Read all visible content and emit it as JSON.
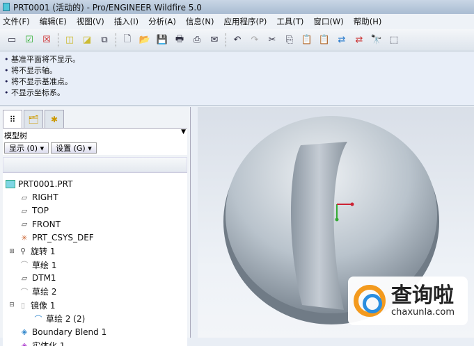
{
  "title": "PRT0001 (活动的) - Pro/ENGINEER Wildfire 5.0",
  "menu": [
    "文件(F)",
    "编辑(E)",
    "视图(V)",
    "插入(I)",
    "分析(A)",
    "信息(N)",
    "应用程序(P)",
    "工具(T)",
    "窗口(W)",
    "帮助(H)"
  ],
  "messages": [
    "基准平面将不显示。",
    "将不显示轴。",
    "将不显示基准点。",
    "不显示坐标系。"
  ],
  "model_tree": {
    "label": "模型树",
    "show_button": "显示 (0) ▾",
    "settings_button": "设置 (G) ▾",
    "nodes": [
      {
        "label": "PRT0001.PRT",
        "icon": "part-icon"
      },
      {
        "label": "RIGHT",
        "icon": "datum-plane-icon"
      },
      {
        "label": "TOP",
        "icon": "datum-plane-icon"
      },
      {
        "label": "FRONT",
        "icon": "datum-plane-icon"
      },
      {
        "label": "PRT_CSYS_DEF",
        "icon": "csys-icon"
      },
      {
        "label": "旋转 1",
        "icon": "revolve-icon"
      },
      {
        "label": "草绘 1",
        "icon": "sketch-icon"
      },
      {
        "label": "DTM1",
        "icon": "datum-plane-icon"
      },
      {
        "label": "草绘 2",
        "icon": "sketch-icon"
      },
      {
        "label": "镜像 1",
        "icon": "mirror-icon"
      },
      {
        "label": "草绘 2 (2)",
        "icon": "sketch-icon"
      },
      {
        "label": "Boundary Blend 1",
        "icon": "blend-icon"
      },
      {
        "label": "实体化 1",
        "icon": "solidify-icon"
      }
    ]
  },
  "watermark": {
    "name": "查询啦",
    "url": "chaxunla.com"
  }
}
